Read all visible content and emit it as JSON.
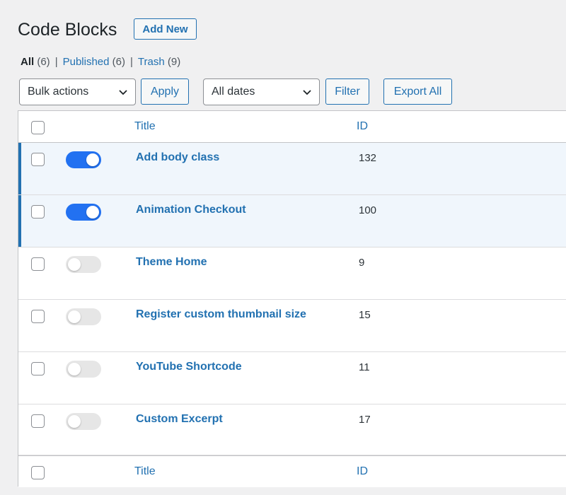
{
  "header": {
    "title": "Code Blocks",
    "add_new_label": "Add New"
  },
  "filters": {
    "views": [
      {
        "label": "All",
        "count": "(6)",
        "current": true
      },
      {
        "label": "Published",
        "count": "(6)",
        "current": false
      },
      {
        "label": "Trash",
        "count": "(9)",
        "current": false
      }
    ],
    "separator": "|",
    "bulk_actions": "Bulk actions",
    "apply_label": "Apply",
    "dates": "All dates",
    "filter_label": "Filter",
    "export_label": "Export All"
  },
  "table": {
    "columns": {
      "title": "Title",
      "id": "ID"
    },
    "rows": [
      {
        "title": "Add body class",
        "id": "132",
        "active": true
      },
      {
        "title": "Animation Checkout",
        "id": "100",
        "active": true
      },
      {
        "title": "Theme Home",
        "id": "9",
        "active": false
      },
      {
        "title": "Register custom thumbnail size",
        "id": "15",
        "active": false
      },
      {
        "title": "YouTube Shortcode",
        "id": "11",
        "active": false
      },
      {
        "title": "Custom Excerpt",
        "id": "17",
        "active": false
      }
    ]
  },
  "colors": {
    "accent": "#2271b1",
    "toggle_on": "#2271f1",
    "toggle_off": "#e6e6e6",
    "active_row_bg": "#f0f6fc",
    "page_bg": "#f0f0f1"
  }
}
